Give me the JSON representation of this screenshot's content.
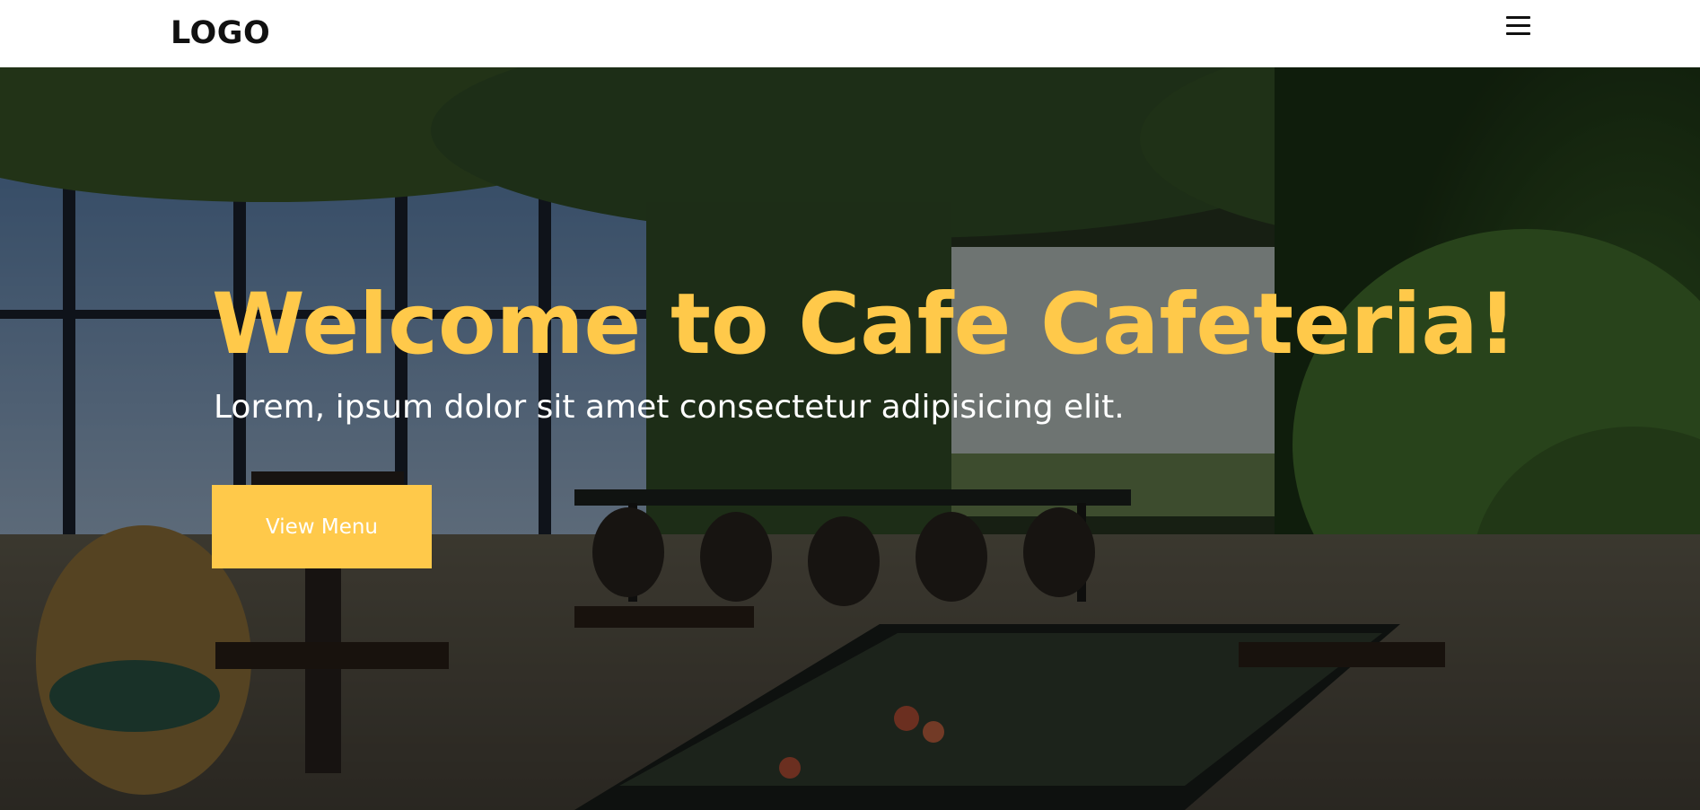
{
  "nav": {
    "logo": "LOGO",
    "menu_icon": "hamburger-menu-icon"
  },
  "hero": {
    "title": "Welcome to Cafe Cafeteria!",
    "subtitle": "Lorem, ipsum dolor sit amet consectetur adipisicing elit.",
    "cta_label": "View Menu",
    "background_image": "cafe-interior-photo"
  },
  "colors": {
    "accent": "#ffc94a",
    "navbar_bg": "#ffffff",
    "hero_text": "#ffffff"
  }
}
